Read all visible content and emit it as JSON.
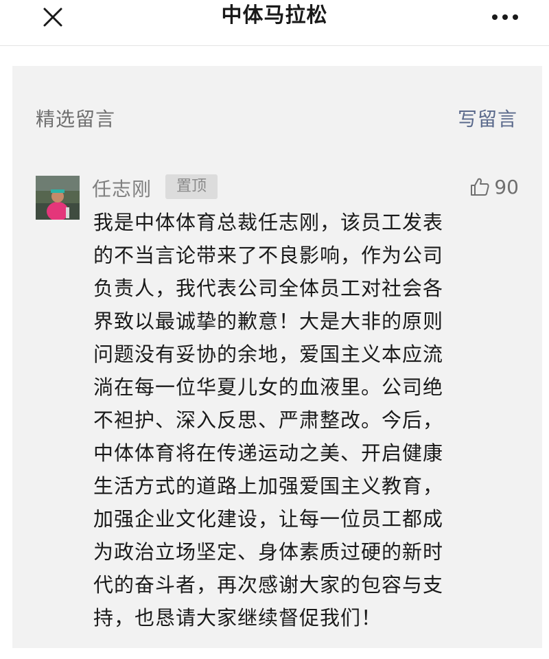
{
  "header": {
    "title": "中体马拉松",
    "close_icon": "close-icon",
    "more_icon": "more-icon"
  },
  "comments_section": {
    "title": "精选留言",
    "write_label": "写留言"
  },
  "comment": {
    "author": "任志刚",
    "badge": "置顶",
    "likes": "90",
    "like_icon": "thumbs-up-icon",
    "lines": [
      "我是中体体育总裁任志刚，该员工发表",
      "的不当言论带来了不良影响，作为公司",
      "负责人，我代表公司全体员工对社会各",
      "界致以最诚挚的歉意！大是大非的原则",
      "问题没有妥协的余地，爱国主义本应流",
      "淌在每一位华夏儿女的血液里。公司绝",
      "不袒护、深入反思、严肃整改。今后，",
      "中体体育将在传递运动之美、开启健康",
      "生活方式的道路上加强爱国主义教育，",
      "加强企业文化建设，让每一位员工都成",
      "为政治立场坚定、身体素质过硬的新时",
      "代的奋斗者，再次感谢大家的包容与支",
      "持，也恳请大家继续督促我们！"
    ]
  },
  "colors": {
    "link": "#5b6a8c",
    "panel_bg": "#f2f2f2",
    "muted_text": "#6f6f6f"
  }
}
